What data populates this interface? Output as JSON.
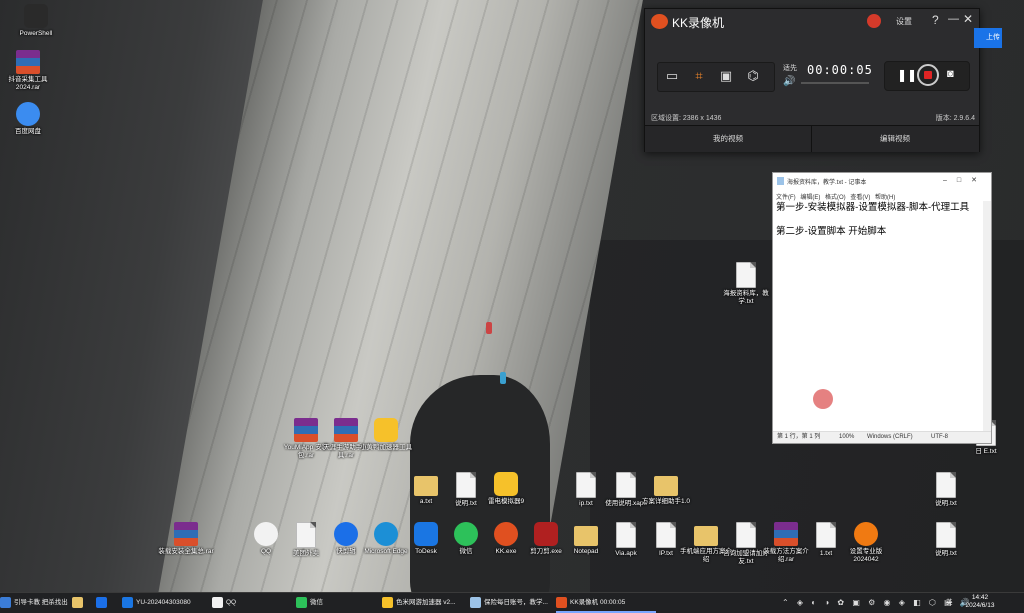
{
  "desktop_icons": [
    {
      "label": "PowerShell",
      "kind": "sq",
      "color": "#2a2a2a"
    },
    {
      "label": "抖音采集工具 2024.rar",
      "kind": "rar"
    },
    {
      "label": "百度网盘",
      "kind": "app",
      "color": "#3b8cf0"
    },
    {
      "label": "YouMiApp 安装包.rar",
      "kind": "rar"
    },
    {
      "label": "天涯手游助手工具.rar",
      "kind": "rar"
    },
    {
      "label": "小黄鸭加速器工具",
      "kind": "sq",
      "color": "#f6c12a"
    },
    {
      "label": "a.txt",
      "kind": "folder"
    },
    {
      "label": "说明.txt",
      "kind": "file"
    },
    {
      "label": "雷电模拟器9",
      "kind": "sq",
      "color": "#f6c12a"
    },
    {
      "label": "ip.txt",
      "kind": "file"
    },
    {
      "label": "使用说明.xapk",
      "kind": "file"
    },
    {
      "label": "方案详细助手1.0",
      "kind": "folder"
    },
    {
      "label": "说明.txt",
      "kind": "file"
    },
    {
      "label": "装载安装全集总.rar",
      "kind": "rar"
    },
    {
      "label": "QQ",
      "kind": "app",
      "color": "#f2f2f2"
    },
    {
      "label": "美团外卖",
      "kind": "file"
    },
    {
      "label": "快剪辑",
      "kind": "app",
      "color": "#1b6fe8"
    },
    {
      "label": "Microsoft Edge",
      "kind": "app",
      "color": "#1c8fd6"
    },
    {
      "label": "ToDesk",
      "kind": "sq",
      "color": "#1a76e3"
    },
    {
      "label": "微信",
      "kind": "app",
      "color": "#2dc15a"
    },
    {
      "label": "KK.exe",
      "kind": "app",
      "color": "#e05020"
    },
    {
      "label": "剪刀剪.exe",
      "kind": "sq",
      "color": "#b02020"
    },
    {
      "label": "Notepad",
      "kind": "folder"
    },
    {
      "label": "Via.apk",
      "kind": "file"
    },
    {
      "label": "IP.txt",
      "kind": "file"
    },
    {
      "label": "手机端应用方案介绍",
      "kind": "folder"
    },
    {
      "label": "咨询加盟请加好友.txt",
      "kind": "file"
    },
    {
      "label": "装载方法方案介绍.rar",
      "kind": "rar"
    },
    {
      "label": "1.txt",
      "kind": "file"
    },
    {
      "label": "设置专业版 2024042",
      "kind": "app",
      "color": "#f07a12"
    },
    {
      "label": "说明.txt",
      "kind": "file"
    },
    {
      "label": "海报资料库，教学.txt",
      "kind": "file"
    },
    {
      "label": "日 E.txt",
      "kind": "file"
    }
  ],
  "kk": {
    "title": "KK录像机",
    "settings": "设置",
    "help": "?",
    "minimize": "—",
    "close": "✕",
    "audio_label": "适先",
    "timer": "00:00:05",
    "area_label": "区域设置: 2386 x 1436",
    "version": "版本: 2.9.6.4",
    "tab_my_videos": "我的视频",
    "tab_edit_video": "编辑视频"
  },
  "notepad": {
    "title": "海报资料库，教学.txt - 记事本",
    "menu": "文件(F) 编辑(E) 格式(O) 查看(V) 帮助(H)",
    "content": "第一步-安装模拟器-设置模拟器-脚本-代理工具\n\n第二步-设置脚本 开始脚本",
    "status_pos": "第 1 行，第 1 列",
    "status_zoom": "100%",
    "status_eol": "Windows (CRLF)",
    "status_enc": "UTF-8"
  },
  "right_clip": {
    "button": "上传"
  },
  "taskbar": {
    "items": [
      {
        "label": "引导卡教 把杀找出..",
        "color": "#3b7dd8"
      },
      {
        "label": "",
        "color": "#e8c46a"
      },
      {
        "label": "",
        "color": "#1b6fe8"
      },
      {
        "label": "YU-202404303080",
        "color": "#1a76e3"
      },
      {
        "label": "QQ",
        "color": "#f2f2f2"
      },
      {
        "label": "微信",
        "color": "#2dc15a"
      },
      {
        "label": "色米网游加速器 v2...",
        "color": "#f6c12a"
      },
      {
        "label": "保险每日账号，教学...",
        "color": "#9cc3e8"
      },
      {
        "label": "KK录像机 00:00:05",
        "color": "#e05020"
      }
    ],
    "tray_icons": "⌃ ◈ ◐ ◑ ✿ ▣ ⚙ ◉ ◈ ◧ ⬡ ▤ 🔊",
    "ime": "英",
    "time": "14:42",
    "date": "2024/6/13"
  }
}
